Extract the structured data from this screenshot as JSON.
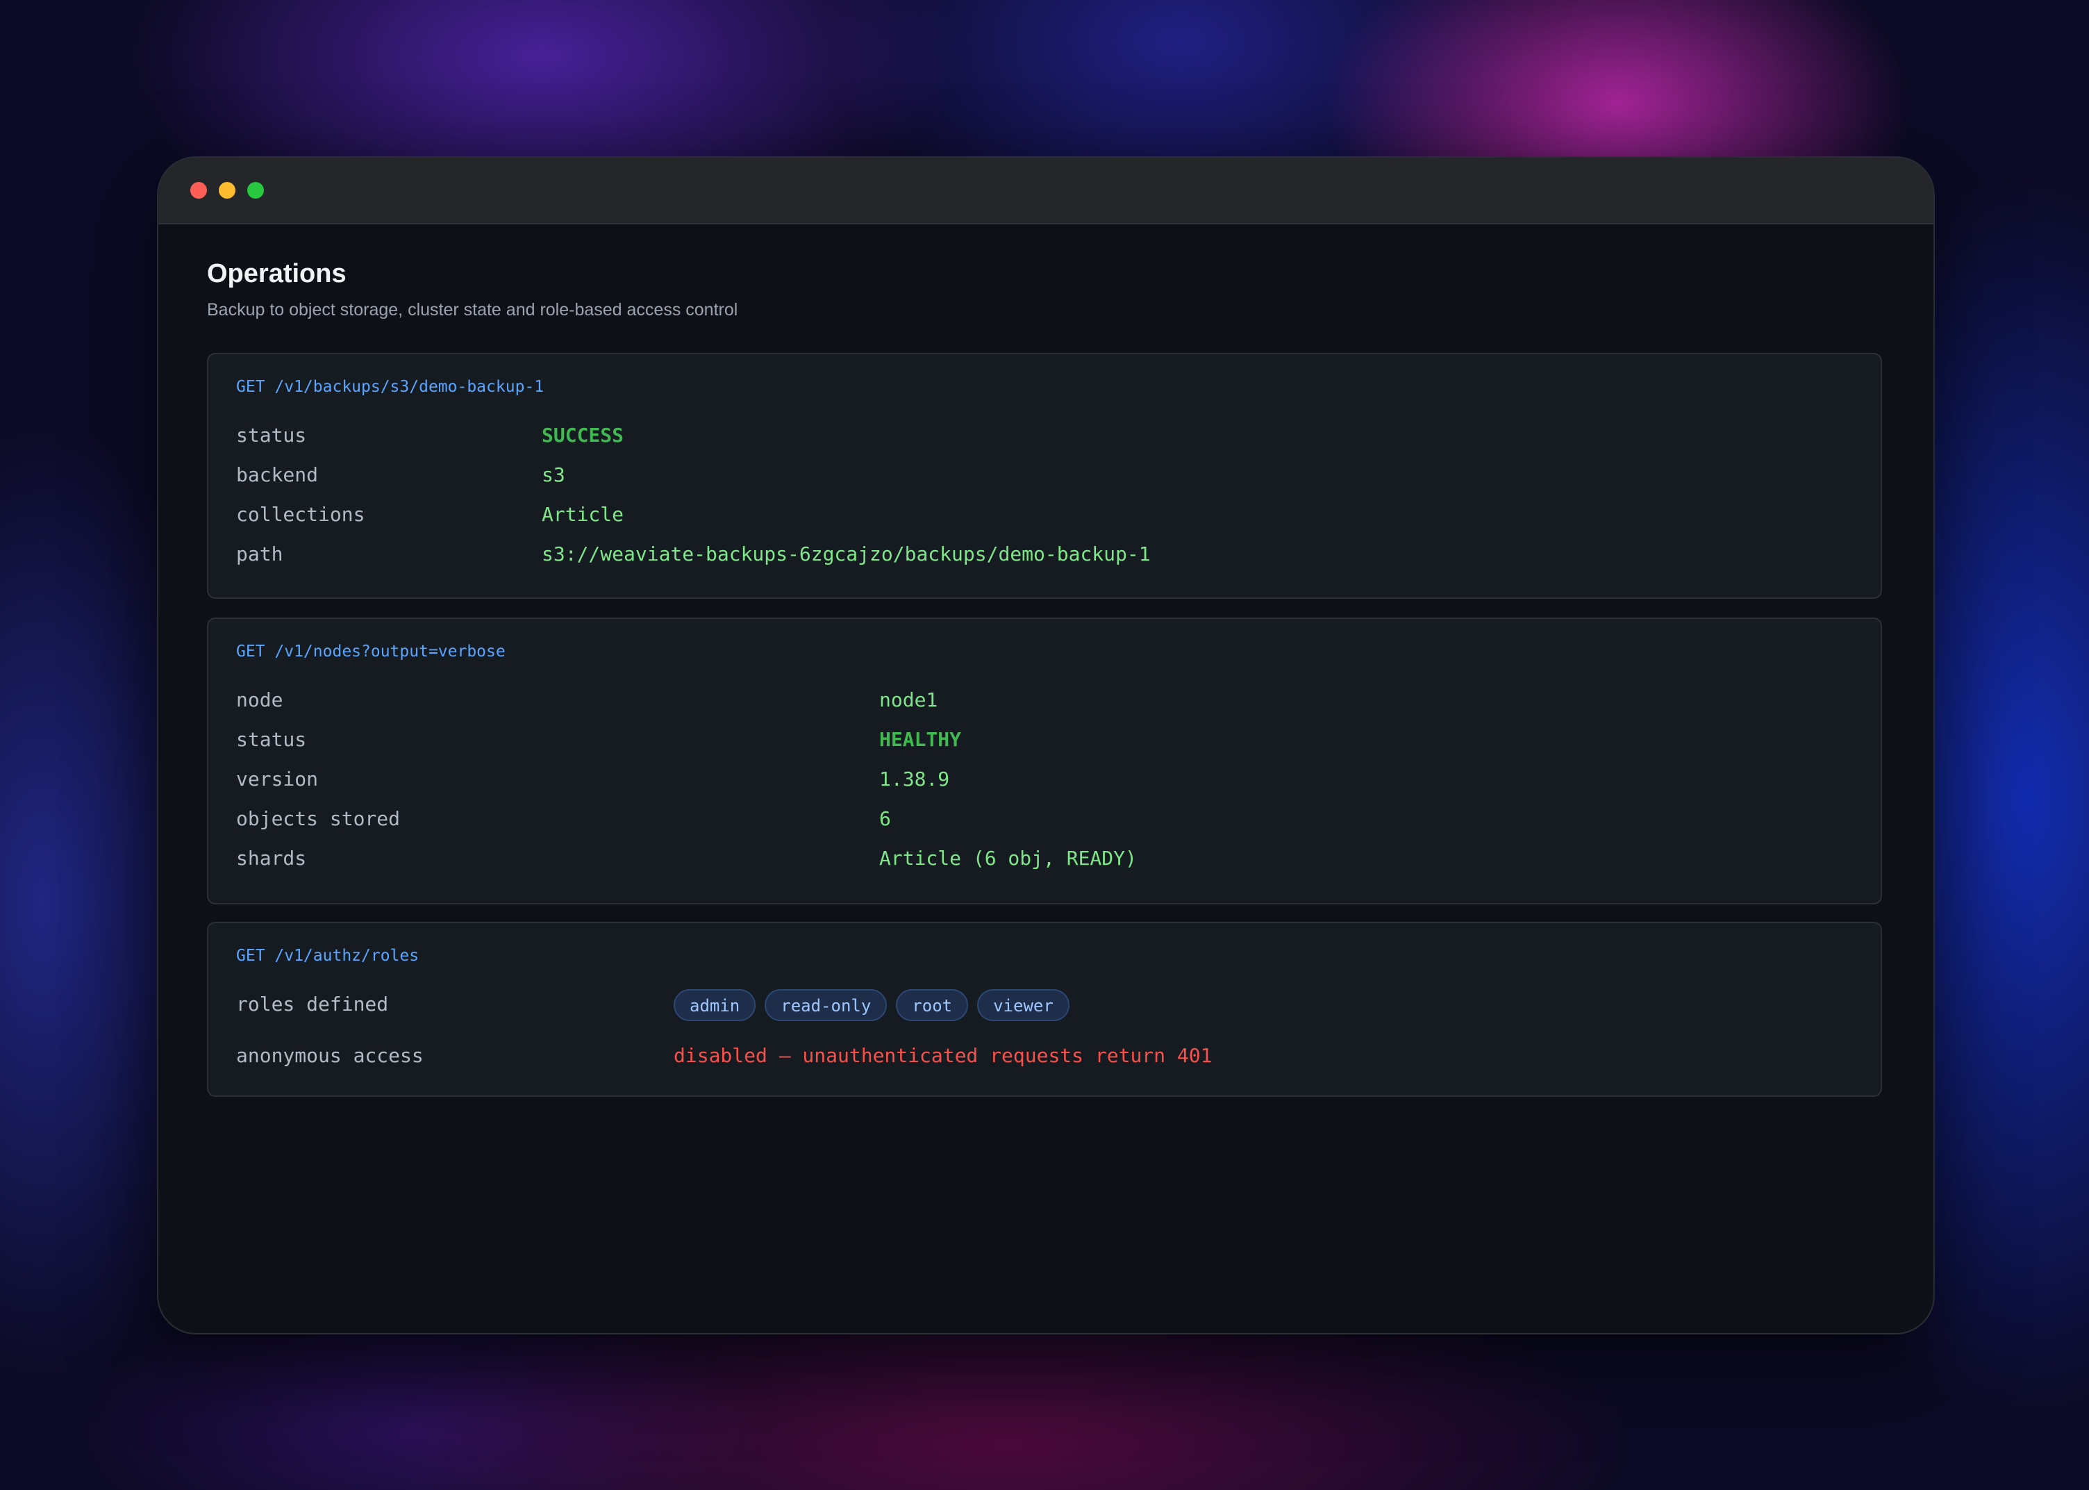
{
  "page": {
    "title": "Operations",
    "subtitle": "Backup to object storage, cluster state and role-based access control"
  },
  "backup": {
    "endpoint": "GET /v1/backups/s3/demo-backup-1",
    "rows": [
      {
        "key": "status",
        "value": "SUCCESS"
      },
      {
        "key": "backend",
        "value": "s3"
      },
      {
        "key": "collections",
        "value": "Article"
      },
      {
        "key": "path",
        "value": "s3://weaviate-backups-6zgcajzo/backups/demo-backup-1"
      }
    ]
  },
  "nodes": {
    "endpoint": "GET /v1/nodes?output=verbose",
    "rows": [
      {
        "key": "node",
        "value": "node1"
      },
      {
        "key": "status",
        "value": "HEALTHY"
      },
      {
        "key": "version",
        "value": "1.38.9"
      },
      {
        "key": "objects stored",
        "value": "6"
      },
      {
        "key": "shards",
        "value": "Article (6 obj, READY)"
      }
    ]
  },
  "roles": {
    "endpoint": "GET /v1/authz/roles",
    "roles_label": "roles defined",
    "roles": [
      "admin",
      "read-only",
      "root",
      "viewer"
    ],
    "anonymous_label": "anonymous access",
    "anonymous_value": "disabled — unauthenticated requests return 401"
  },
  "colors": {
    "endpoint": "#58a6ff",
    "value": "#7ee787",
    "success": "#3fb950",
    "danger": "#f85149",
    "pill_bg": "#1d2d4a",
    "pill_text": "#9ec6ff"
  }
}
